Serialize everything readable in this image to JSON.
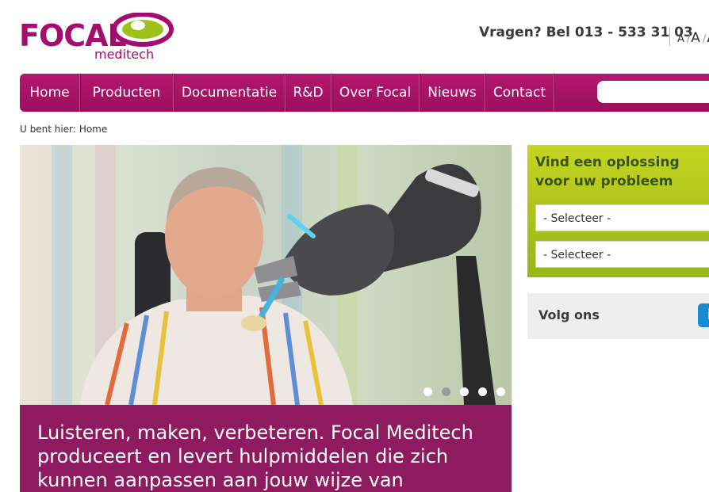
{
  "header": {
    "logo_text": "FOCAL",
    "logo_sub": "meditech",
    "phone": "Vragen? Bel 013 - 533 31 03",
    "font_sizes": [
      "A",
      "A",
      "A"
    ]
  },
  "nav": {
    "items": [
      {
        "label": "Home"
      },
      {
        "label": "Producten"
      },
      {
        "label": "Documentatie"
      },
      {
        "label": "R&D"
      },
      {
        "label": "Over Focal"
      },
      {
        "label": "Nieuws"
      },
      {
        "label": "Contact"
      }
    ],
    "search": {
      "value": "",
      "placeholder": ""
    }
  },
  "breadcrumb": {
    "prefix": "U bent hier:",
    "current": "Home"
  },
  "hero": {
    "caption": "Luisteren, maken, verbeteren. Focal Meditech produceert en levert hulpmiddelen die zich kunnen aanpassen aan jouw  wijze van",
    "slide_count": 5,
    "active_slide": 2
  },
  "sidebar": {
    "solution": {
      "title_line1": "Vind een oplossing",
      "title_line2": "voor uw probleem",
      "select1": "- Selecteer -",
      "select2": "- Selecteer -"
    },
    "follow": {
      "label": "Volg ons",
      "icon": "linkedin-icon"
    }
  },
  "colors": {
    "brand": "#a30d6e",
    "nav": "#aa1468",
    "green": "#b3c81d",
    "caption_bg": "#8e1a5f"
  }
}
